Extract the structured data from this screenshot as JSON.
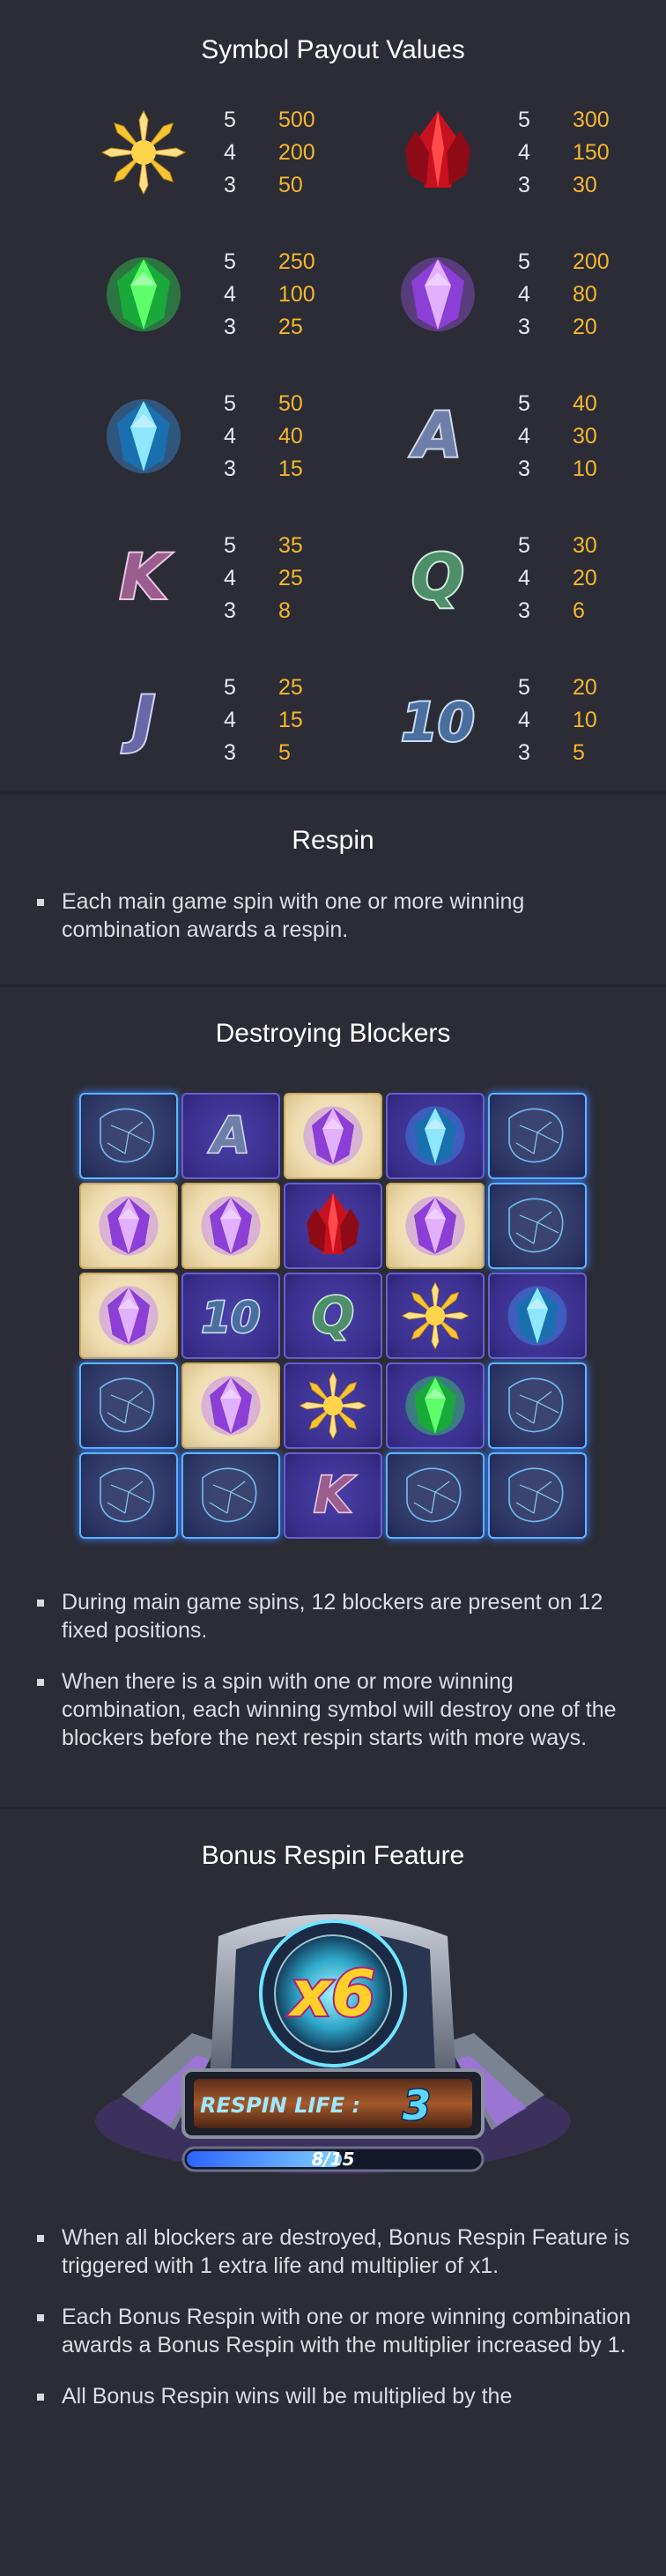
{
  "payouts": {
    "title": "Symbol Payout Values",
    "symbols": [
      {
        "icon": "gold-crystal-icon",
        "rows": [
          {
            "count": "5",
            "value": "500"
          },
          {
            "count": "4",
            "value": "200"
          },
          {
            "count": "3",
            "value": "50"
          }
        ]
      },
      {
        "icon": "red-crystal-icon",
        "rows": [
          {
            "count": "5",
            "value": "300"
          },
          {
            "count": "4",
            "value": "150"
          },
          {
            "count": "3",
            "value": "30"
          }
        ]
      },
      {
        "icon": "green-gem-icon",
        "rows": [
          {
            "count": "5",
            "value": "250"
          },
          {
            "count": "4",
            "value": "100"
          },
          {
            "count": "3",
            "value": "25"
          }
        ]
      },
      {
        "icon": "purple-gem-icon",
        "rows": [
          {
            "count": "5",
            "value": "200"
          },
          {
            "count": "4",
            "value": "80"
          },
          {
            "count": "3",
            "value": "20"
          }
        ]
      },
      {
        "icon": "blue-gem-icon",
        "rows": [
          {
            "count": "5",
            "value": "50"
          },
          {
            "count": "4",
            "value": "40"
          },
          {
            "count": "3",
            "value": "15"
          }
        ]
      },
      {
        "icon": "letter-a-icon",
        "rows": [
          {
            "count": "5",
            "value": "40"
          },
          {
            "count": "4",
            "value": "30"
          },
          {
            "count": "3",
            "value": "10"
          }
        ]
      },
      {
        "icon": "letter-k-icon",
        "rows": [
          {
            "count": "5",
            "value": "35"
          },
          {
            "count": "4",
            "value": "25"
          },
          {
            "count": "3",
            "value": "8"
          }
        ]
      },
      {
        "icon": "letter-q-icon",
        "rows": [
          {
            "count": "5",
            "value": "30"
          },
          {
            "count": "4",
            "value": "20"
          },
          {
            "count": "3",
            "value": "6"
          }
        ]
      },
      {
        "icon": "letter-j-icon",
        "rows": [
          {
            "count": "5",
            "value": "25"
          },
          {
            "count": "4",
            "value": "15"
          },
          {
            "count": "3",
            "value": "5"
          }
        ]
      },
      {
        "icon": "number-10-icon",
        "rows": [
          {
            "count": "5",
            "value": "20"
          },
          {
            "count": "4",
            "value": "10"
          },
          {
            "count": "3",
            "value": "5"
          }
        ]
      }
    ]
  },
  "respin": {
    "title": "Respin",
    "bullets": [
      "Each main game spin with one or more winning combination awards a respin."
    ]
  },
  "blockers": {
    "title": "Destroying Blockers",
    "board": [
      [
        "blocker",
        "A",
        "purple",
        "blue",
        "blocker"
      ],
      [
        "purple",
        "purple",
        "red",
        "purple",
        "blocker"
      ],
      [
        "purple",
        "10",
        "Q",
        "gold",
        "blue"
      ],
      [
        "blocker",
        "purple",
        "gold",
        "green",
        "blocker"
      ],
      [
        "blocker",
        "blocker",
        "K",
        "blocker",
        "blocker"
      ]
    ],
    "bullets": [
      "During main game spins, 12 blockers are present on 12 fixed positions.",
      "When there is a spin with one or more winning combination, each winning symbol will destroy one of the blockers before the next respin starts with more ways."
    ]
  },
  "bonus": {
    "title": "Bonus Respin Feature",
    "multiplier_text": "x6",
    "respin_label": "RESPIN LIFE :",
    "respin_life": "3",
    "progress_text": "8/15",
    "progress_fraction": 0.53,
    "bullets": [
      "When all blockers are destroyed, Bonus Respin Feature is triggered with 1 extra life and multiplier of x1.",
      "Each Bonus Respin with one or more winning combination awards a Bonus Respin with the multiplier increased by 1.",
      "All Bonus Respin wins will be multiplied by the"
    ]
  },
  "colors": {
    "background": "#2b2c36",
    "payout_value": "#f5b72a",
    "heading": "#ffffff"
  }
}
